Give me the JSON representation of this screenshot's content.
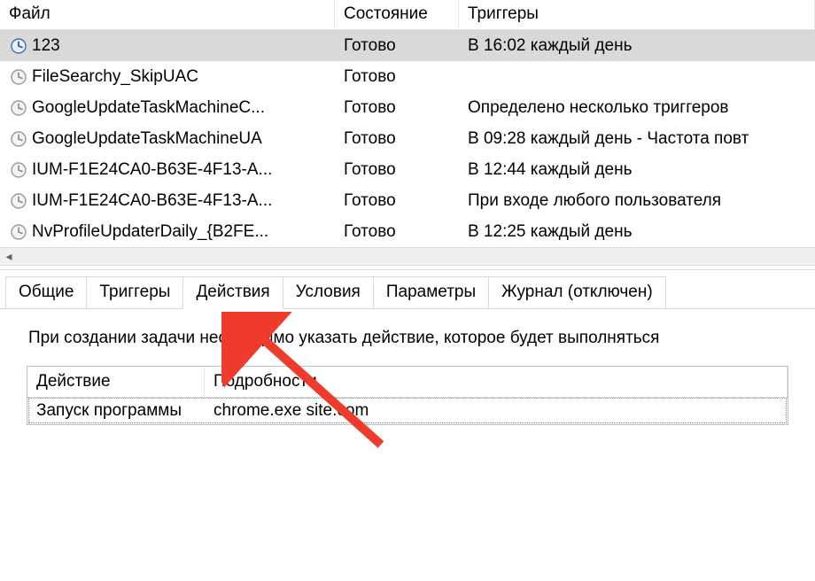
{
  "columns": {
    "file": "Файл",
    "state": "Состояние",
    "triggers": "Триггеры"
  },
  "tasks": [
    {
      "name": "123",
      "state": "Готово",
      "trigger": "В 16:02 каждый день",
      "selected": true,
      "icon": "color"
    },
    {
      "name": "FileSearchy_SkipUAC",
      "state": "Готово",
      "trigger": "",
      "selected": false,
      "icon": "gray"
    },
    {
      "name": "GoogleUpdateTaskMachineC...",
      "state": "Готово",
      "trigger": "Определено несколько триггеров",
      "selected": false,
      "icon": "gray"
    },
    {
      "name": "GoogleUpdateTaskMachineUA",
      "state": "Готово",
      "trigger": "В 09:28 каждый день - Частота повт",
      "selected": false,
      "icon": "gray"
    },
    {
      "name": "IUM-F1E24CA0-B63E-4F13-A...",
      "state": "Готово",
      "trigger": "В 12:44 каждый день",
      "selected": false,
      "icon": "gray"
    },
    {
      "name": "IUM-F1E24CA0-B63E-4F13-A...",
      "state": "Готово",
      "trigger": "При входе любого пользователя",
      "selected": false,
      "icon": "gray"
    },
    {
      "name": "NvProfileUpdaterDaily_{B2FE...",
      "state": "Готово",
      "trigger": "В 12:25 каждый день",
      "selected": false,
      "icon": "gray"
    }
  ],
  "tabs": {
    "items": [
      "Общие",
      "Триггеры",
      "Действия",
      "Условия",
      "Параметры",
      "Журнал (отключен)"
    ],
    "active_index": 2
  },
  "tab_content": {
    "description": "При создании задачи необходимо указать действие, которое будет выполняться",
    "action_columns": {
      "action": "Действие",
      "details": "Подробности"
    },
    "action_row": {
      "action": "Запуск программы",
      "details": "chrome.exe site.com"
    }
  },
  "annotation": {
    "color": "#ef3b2c"
  }
}
